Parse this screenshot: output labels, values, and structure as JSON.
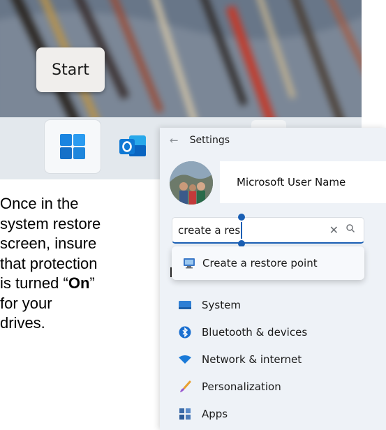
{
  "tooltip": {
    "label": "Start"
  },
  "taskbar": {
    "items": [
      {
        "name": "start",
        "icon": "windows-logo-icon"
      },
      {
        "name": "outlook",
        "icon": "outlook-icon"
      }
    ]
  },
  "instructions": {
    "before_bold": "Once in the\nsystem restore\nscreen, insure\nthat protection\nis turned “",
    "bold": "On",
    "after_bold": "”\nfor your\ndrives."
  },
  "settings": {
    "title": "Settings",
    "back_icon": "←",
    "user_name": "Microsoft User Name",
    "search": {
      "value": "create a res",
      "clear_glyph": "✕"
    },
    "suggestion": {
      "label": "Create a restore point",
      "icon": "restore-point-icon"
    },
    "nav": [
      {
        "label": "System",
        "icon": "system-icon"
      },
      {
        "label": "Bluetooth & devices",
        "icon": "bluetooth-icon"
      },
      {
        "label": "Network & internet",
        "icon": "wifi-icon"
      },
      {
        "label": "Personalization",
        "icon": "brush-icon"
      },
      {
        "label": "Apps",
        "icon": "apps-icon"
      }
    ]
  },
  "colors": {
    "accent": "#1a5fb4",
    "settings_bg": "#eef2f7",
    "taskbar_bg": "#e3e8ed"
  }
}
